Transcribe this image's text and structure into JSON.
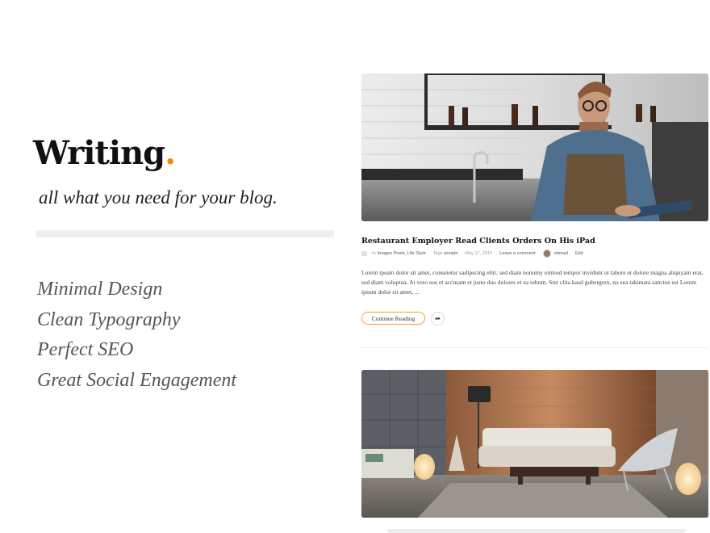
{
  "hero": {
    "logo_text": "Writing",
    "logo_dot": ".",
    "tagline": "all what you need for your blog."
  },
  "features": [
    "Minimal Design",
    "Clean Typography",
    "Perfect SEO",
    "Great Social Engagement"
  ],
  "post": {
    "title": "Restaurant Employer Read Clients Orders On His iPad",
    "meta": {
      "in_prefix": "In",
      "categories": "Images Posts, Life Style",
      "tags_prefix": "Tags",
      "tags": "people",
      "date": "May 17, 2015",
      "comment": "Leave a comment",
      "author": "ahmad",
      "edit": "Edit"
    },
    "excerpt": "Lorem ipsum dolor sit amet, consetetur sadipscing elitr, sed diam nonumy eirmod tempor invidunt ut labore et dolore magna aliquyam erat, sed diam voluptua. At vero eos et accusam et justo duo dolores et ea rebum. Stet clita kasd gubergren, no sea takimata sanctus est Lorem ipsum dolor sit amet, ...",
    "continue_label": "Continue Reading",
    "share_icon": "share-icon"
  },
  "colors": {
    "accent": "#f08a00",
    "button_border": "#f0a030"
  }
}
